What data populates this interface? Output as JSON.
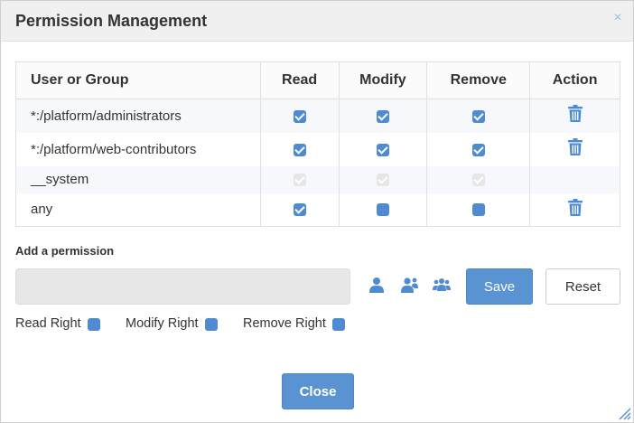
{
  "dialog": {
    "title": "Permission Management",
    "close_icon": "close-x-icon",
    "close_glyph": "×"
  },
  "table": {
    "headers": [
      "User or Group",
      "Read",
      "Modify",
      "Remove",
      "Action"
    ],
    "rows": [
      {
        "name": "*:/platform/administrators",
        "read": true,
        "modify": true,
        "remove": true,
        "disabled": false,
        "deletable": true
      },
      {
        "name": "*:/platform/web-contributors",
        "read": true,
        "modify": true,
        "remove": true,
        "disabled": false,
        "deletable": true
      },
      {
        "name": "__system",
        "read": true,
        "modify": true,
        "remove": true,
        "disabled": true,
        "deletable": false
      },
      {
        "name": "any",
        "read": true,
        "modify": false,
        "remove": false,
        "disabled": false,
        "deletable": true
      }
    ]
  },
  "add_permission": {
    "label": "Add a permission",
    "input_value": "",
    "input_placeholder": "",
    "save_label": "Save",
    "reset_label": "Reset",
    "icons": [
      "select-user-icon",
      "select-membership-icon",
      "select-group-icon"
    ]
  },
  "rights": {
    "read_label": "Read Right",
    "read_checked": false,
    "modify_label": "Modify Right",
    "modify_checked": false,
    "remove_label": "Remove Right",
    "remove_checked": false
  },
  "footer": {
    "close_label": "Close"
  },
  "colors": {
    "accent": "#5a93d1",
    "checkbox": "#4f8bd0",
    "checkbox_disabled": "#e6e6e6",
    "header_bg": "#f0f0f0"
  }
}
